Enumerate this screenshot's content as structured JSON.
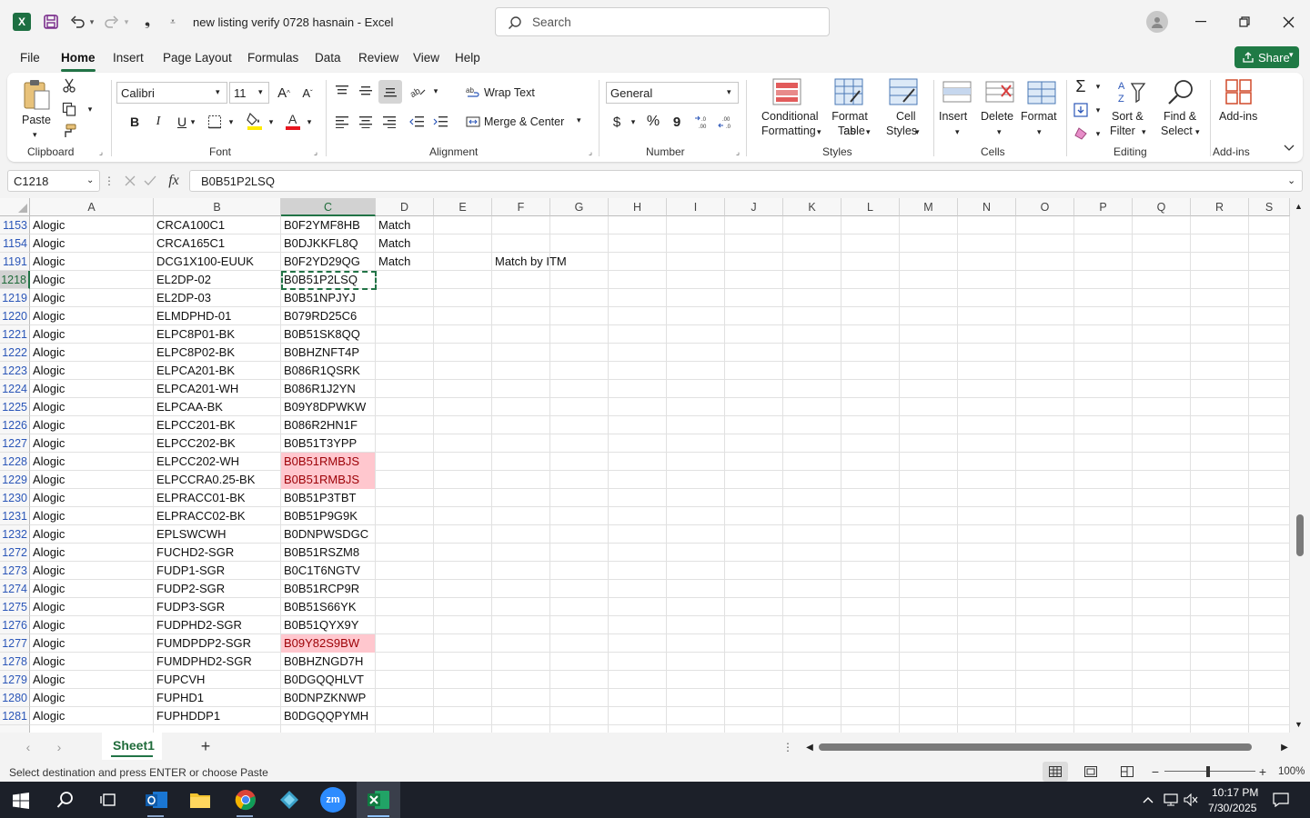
{
  "title_bar": {
    "file_name": "new listing verify 0728 hasnain",
    "app": "Excel",
    "separator": "-",
    "search_placeholder": "Search"
  },
  "menu": [
    "File",
    "Home",
    "Insert",
    "Page Layout",
    "Formulas",
    "Data",
    "Review",
    "View",
    "Help"
  ],
  "share_label": "Share",
  "ribbon": {
    "clipboard": {
      "paste": "Paste",
      "group": "Clipboard"
    },
    "font": {
      "name": "Calibri",
      "size": "11",
      "bold": "B",
      "italic": "I",
      "underline": "U",
      "group": "Font"
    },
    "alignment": {
      "wrap": "Wrap Text",
      "merge": "Merge & Center",
      "group": "Alignment"
    },
    "number": {
      "format": "General",
      "currency": "$",
      "percent": "%",
      "comma": "9",
      "group": "Number"
    },
    "styles": {
      "cond_line1": "Conditional",
      "cond_line2": "Formatting",
      "table_line1": "Format as",
      "table_line2": "Table",
      "cell_line1": "Cell",
      "cell_line2": "Styles",
      "group": "Styles"
    },
    "cells": {
      "insert": "Insert",
      "delete": "Delete",
      "format": "Format",
      "group": "Cells"
    },
    "editing": {
      "sort_line1": "Sort &",
      "sort_line2": "Filter",
      "find_line1": "Find &",
      "find_line2": "Select",
      "group": "Editing"
    },
    "addins": {
      "label": "Add-ins",
      "group": "Add-ins"
    }
  },
  "formula_bar": {
    "name_box": "C1218",
    "fx": "fx",
    "value": "B0B51P2LSQ"
  },
  "columns": [
    "A",
    "B",
    "C",
    "D",
    "E",
    "F",
    "G",
    "H",
    "I",
    "J",
    "K",
    "L",
    "M",
    "N",
    "O",
    "P",
    "Q",
    "R",
    "S"
  ],
  "rows": [
    {
      "n": "1153",
      "a": "Alogic",
      "b": "CRCA100C1",
      "c": "B0F2YMF8HB",
      "d": "Match",
      "f": "",
      "hl": false
    },
    {
      "n": "1154",
      "a": "Alogic",
      "b": "CRCA165C1",
      "c": "B0DJKKFL8Q",
      "d": "Match",
      "f": "",
      "hl": false
    },
    {
      "n": "1191",
      "a": "Alogic",
      "b": "DCG1X100-EUUK",
      "c": "B0F2YD29QG",
      "d": "Match",
      "f": "Match by ITM",
      "hl": false
    },
    {
      "n": "1218",
      "a": "Alogic",
      "b": "EL2DP-02",
      "c": "B0B51P2LSQ",
      "d": "",
      "f": "",
      "hl": false
    },
    {
      "n": "1219",
      "a": "Alogic",
      "b": "EL2DP-03",
      "c": "B0B51NPJYJ",
      "d": "",
      "f": "",
      "hl": false
    },
    {
      "n": "1220",
      "a": "Alogic",
      "b": "ELMDPHD-01",
      "c": "B079RD25C6",
      "d": "",
      "f": "",
      "hl": false
    },
    {
      "n": "1221",
      "a": "Alogic",
      "b": "ELPC8P01-BK",
      "c": "B0B51SK8QQ",
      "d": "",
      "f": "",
      "hl": false
    },
    {
      "n": "1222",
      "a": "Alogic",
      "b": "ELPC8P02-BK",
      "c": "B0BHZNFT4P",
      "d": "",
      "f": "",
      "hl": false
    },
    {
      "n": "1223",
      "a": "Alogic",
      "b": "ELPCA201-BK",
      "c": "B086R1QSRK",
      "d": "",
      "f": "",
      "hl": false
    },
    {
      "n": "1224",
      "a": "Alogic",
      "b": "ELPCA201-WH",
      "c": "B086R1J2YN",
      "d": "",
      "f": "",
      "hl": false
    },
    {
      "n": "1225",
      "a": "Alogic",
      "b": "ELPCAA-BK",
      "c": "B09Y8DPWKW",
      "d": "",
      "f": "",
      "hl": false
    },
    {
      "n": "1226",
      "a": "Alogic",
      "b": "ELPCC201-BK",
      "c": "B086R2HN1F",
      "d": "",
      "f": "",
      "hl": false
    },
    {
      "n": "1227",
      "a": "Alogic",
      "b": "ELPCC202-BK",
      "c": "B0B51T3YPP",
      "d": "",
      "f": "",
      "hl": false
    },
    {
      "n": "1228",
      "a": "Alogic",
      "b": "ELPCC202-WH",
      "c": "B0B51RMBJS",
      "d": "",
      "f": "",
      "hl": true
    },
    {
      "n": "1229",
      "a": "Alogic",
      "b": "ELPCCRA0.25-BK",
      "c": "B0B51RMBJS",
      "d": "",
      "f": "",
      "hl": true
    },
    {
      "n": "1230",
      "a": "Alogic",
      "b": "ELPRACC01-BK",
      "c": "B0B51P3TBT",
      "d": "",
      "f": "",
      "hl": false
    },
    {
      "n": "1231",
      "a": "Alogic",
      "b": "ELPRACC02-BK",
      "c": "B0B51P9G9K",
      "d": "",
      "f": "",
      "hl": false
    },
    {
      "n": "1232",
      "a": "Alogic",
      "b": "EPLSWCWH",
      "c": "B0DNPWSDGC",
      "d": "",
      "f": "",
      "hl": false
    },
    {
      "n": "1272",
      "a": "Alogic",
      "b": "FUCHD2-SGR",
      "c": "B0B51RSZM8",
      "d": "",
      "f": "",
      "hl": false
    },
    {
      "n": "1273",
      "a": "Alogic",
      "b": "FUDP1-SGR",
      "c": "B0C1T6NGTV",
      "d": "",
      "f": "",
      "hl": false
    },
    {
      "n": "1274",
      "a": "Alogic",
      "b": "FUDP2-SGR",
      "c": "B0B51RCP9R",
      "d": "",
      "f": "",
      "hl": false
    },
    {
      "n": "1275",
      "a": "Alogic",
      "b": "FUDP3-SGR",
      "c": "B0B51S66YK",
      "d": "",
      "f": "",
      "hl": false
    },
    {
      "n": "1276",
      "a": "Alogic",
      "b": "FUDPHD2-SGR",
      "c": "B0B51QYX9Y",
      "d": "",
      "f": "",
      "hl": false
    },
    {
      "n": "1277",
      "a": "Alogic",
      "b": "FUMDPDP2-SGR",
      "c": "B09Y82S9BW",
      "d": "",
      "f": "",
      "hl": true
    },
    {
      "n": "1278",
      "a": "Alogic",
      "b": "FUMDPHD2-SGR",
      "c": "B0BHZNGD7H",
      "d": "",
      "f": "",
      "hl": false
    },
    {
      "n": "1279",
      "a": "Alogic",
      "b": "FUPCVH",
      "c": "B0DGQQHLVT",
      "d": "",
      "f": "",
      "hl": false
    },
    {
      "n": "1280",
      "a": "Alogic",
      "b": "FUPHD1",
      "c": "B0DNPZKNWP",
      "d": "",
      "f": "",
      "hl": false
    },
    {
      "n": "1281",
      "a": "Alogic",
      "b": "FUPHDDP1",
      "c": "B0DGQQPYMH",
      "d": "",
      "f": "",
      "hl": false
    }
  ],
  "sheet_tab": "Sheet1",
  "add_sheet": "+",
  "status": {
    "message": "Select destination and press ENTER or choose Paste",
    "zoom": "100%"
  },
  "taskbar": {
    "time": "10:17 PM",
    "date": "7/30/2025"
  },
  "colors": {
    "excel_green": "#217346",
    "highlight_fill": "#ffc7ce",
    "highlight_text": "#9c0006",
    "row_number": "#2b56b8"
  }
}
